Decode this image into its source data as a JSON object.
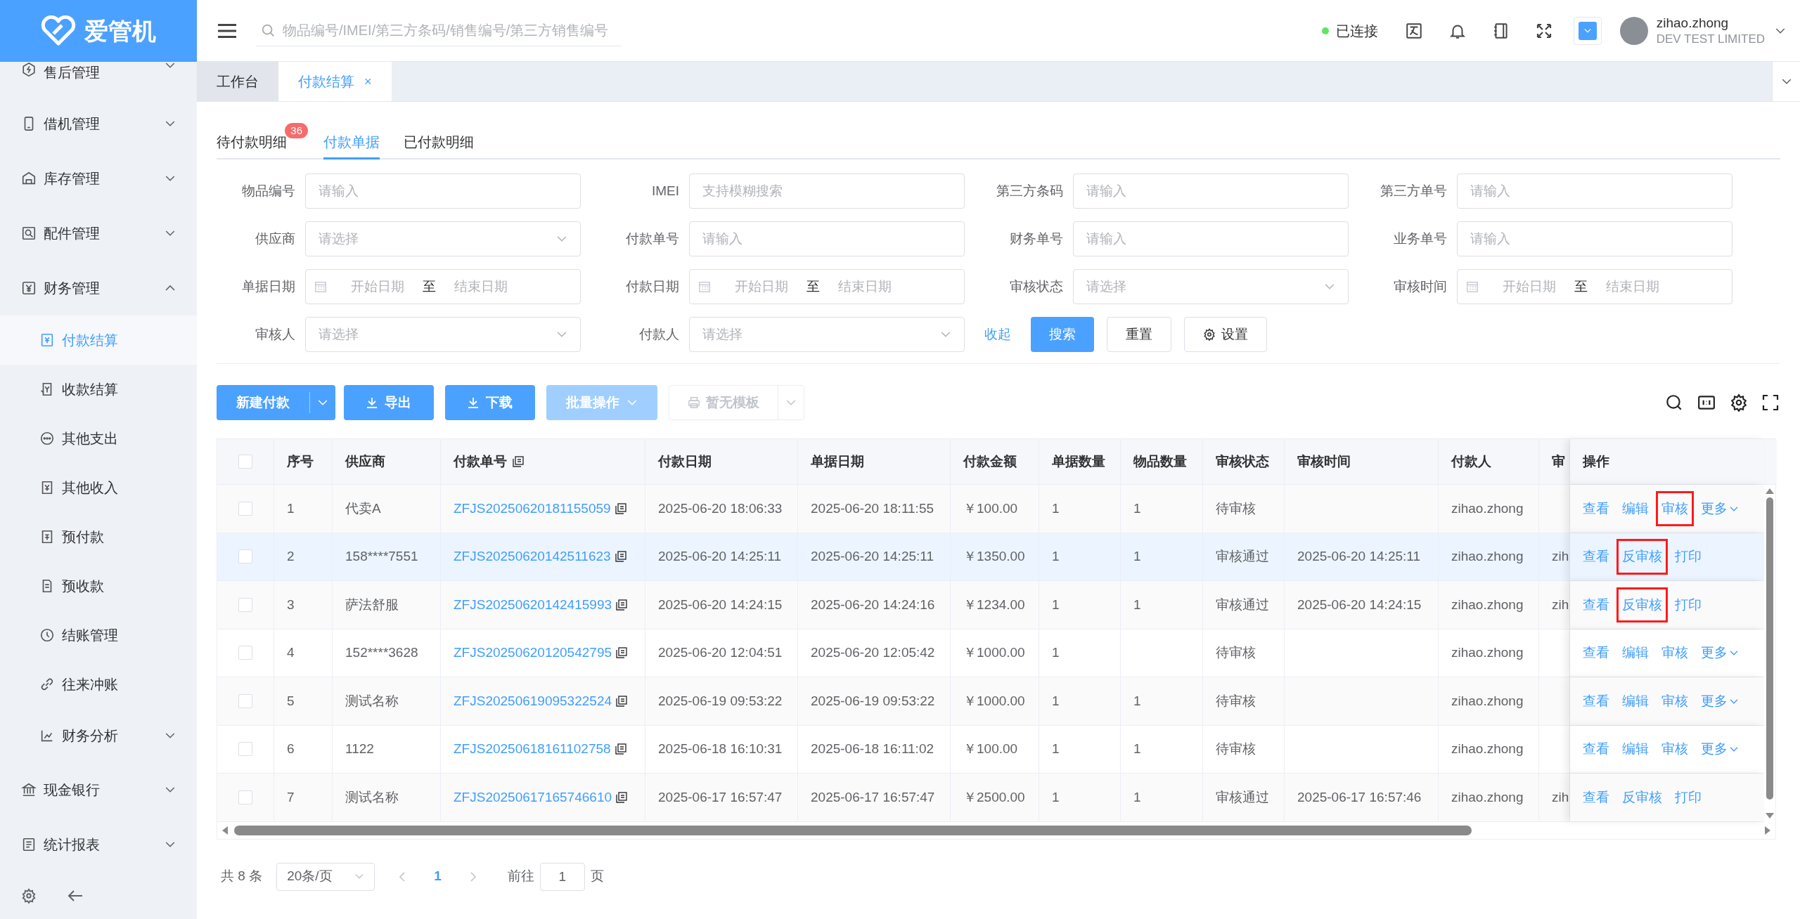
{
  "logo": {
    "text": "爱管机"
  },
  "topbar": {
    "search_placeholder": "物品编号/IMEI/第三方条码/销售编号/第三方销售编号",
    "connection": {
      "label": "已连接",
      "connected": true
    },
    "user": {
      "name": "zihao.zhong",
      "company": "DEV TEST LIMITED"
    }
  },
  "sidebar": {
    "items": [
      {
        "label": "售后管理",
        "expanded": false,
        "selected": false
      },
      {
        "label": "借机管理",
        "expanded": false,
        "selected": false
      },
      {
        "label": "库存管理",
        "expanded": false,
        "selected": false
      },
      {
        "label": "配件管理",
        "expanded": false,
        "selected": false
      },
      {
        "label": "财务管理",
        "expanded": true,
        "selected": false,
        "children": [
          {
            "label": "付款结算",
            "kind": "leaf",
            "selected": true
          },
          {
            "label": "收款结算",
            "kind": "leaf",
            "selected": false
          },
          {
            "label": "其他支出",
            "kind": "leaf",
            "selected": false
          },
          {
            "label": "其他收入",
            "kind": "leaf",
            "selected": false
          },
          {
            "label": "预付款",
            "kind": "leaf",
            "selected": false
          },
          {
            "label": "预收款",
            "kind": "leaf",
            "selected": false
          },
          {
            "label": "结账管理",
            "kind": "leaf",
            "selected": false
          },
          {
            "label": "往来冲账",
            "kind": "leaf",
            "selected": false
          },
          {
            "label": "财务分析",
            "kind": "group",
            "selected": false
          }
        ]
      },
      {
        "label": "现金银行",
        "expanded": false,
        "selected": false
      },
      {
        "label": "统计报表",
        "expanded": false,
        "selected": false
      }
    ]
  },
  "page_tabs": [
    {
      "label": "工作台",
      "selected": false
    },
    {
      "label": "付款结算",
      "selected": true,
      "close": "×"
    }
  ],
  "sub_tabs": [
    {
      "label": "待付款明细",
      "selected": false,
      "badge": "36"
    },
    {
      "label": "付款单据",
      "selected": true
    },
    {
      "label": "已付款明细",
      "selected": false
    }
  ],
  "filters": [
    {
      "label": "物品编号",
      "kind": "input",
      "placeholder": "请输入"
    },
    {
      "label": "IMEI",
      "kind": "input",
      "placeholder": "支持模糊搜索"
    },
    {
      "label": "第三方条码",
      "kind": "input",
      "placeholder": "请输入"
    },
    {
      "label": "第三方单号",
      "kind": "input",
      "placeholder": "请输入"
    },
    {
      "label": "供应商",
      "kind": "select",
      "placeholder": "请选择"
    },
    {
      "label": "付款单号",
      "kind": "input",
      "placeholder": "请输入"
    },
    {
      "label": "财务单号",
      "kind": "input",
      "placeholder": "请输入"
    },
    {
      "label": "业务单号",
      "kind": "input",
      "placeholder": "请输入"
    },
    {
      "label": "单据日期",
      "kind": "daterange",
      "start_placeholder": "开始日期",
      "separator": "至",
      "end_placeholder": "结束日期"
    },
    {
      "label": "付款日期",
      "kind": "daterange",
      "start_placeholder": "开始日期",
      "separator": "至",
      "end_placeholder": "结束日期"
    },
    {
      "label": "审核状态",
      "kind": "select",
      "placeholder": "请选择"
    },
    {
      "label": "审核时间",
      "kind": "daterange",
      "start_placeholder": "开始日期",
      "separator": "至",
      "end_placeholder": "结束日期"
    },
    {
      "label": "审核人",
      "kind": "select",
      "placeholder": "请选择"
    },
    {
      "label": "付款人",
      "kind": "select",
      "placeholder": "请选择"
    }
  ],
  "filter_actions": {
    "collapse": "收起",
    "search": "搜索",
    "reset": "重置",
    "settings": "设置"
  },
  "toolbar": {
    "buttons": [
      {
        "label": "新建付款",
        "kind": "split",
        "disabled": false
      },
      {
        "label": "导出",
        "kind": "download",
        "disabled": false
      },
      {
        "label": "下载",
        "kind": "download",
        "disabled": false
      },
      {
        "label": "批量操作",
        "kind": "dropdown",
        "disabled": true
      },
      {
        "label": "暂无模板",
        "kind": "print",
        "disabled": true
      }
    ]
  },
  "table": {
    "columns": [
      {
        "label": "序号",
        "kind": "text"
      },
      {
        "label": "供应商",
        "kind": "text"
      },
      {
        "label": "付款单号",
        "kind": "link"
      },
      {
        "label": "付款日期",
        "kind": "text"
      },
      {
        "label": "单据日期",
        "kind": "text"
      },
      {
        "label": "付款金额",
        "kind": "text"
      },
      {
        "label": "单据数量",
        "kind": "text"
      },
      {
        "label": "物品数量",
        "kind": "text"
      },
      {
        "label": "审核状态",
        "kind": "text"
      },
      {
        "label": "审核时间",
        "kind": "text"
      },
      {
        "label": "付款人",
        "kind": "text"
      },
      {
        "label": "审",
        "kind": "text"
      }
    ],
    "actions_header": "操作",
    "all_checked": false,
    "rows": [
      {
        "checked": false,
        "selected": false,
        "cells": [
          "1",
          "代卖A",
          "ZFJS20250620181155059",
          "2025-06-20 18:06:33",
          "2025-06-20 18:11:55",
          "￥100.00",
          "1",
          "1",
          "待审核",
          null,
          "zihao.zhong",
          null
        ],
        "actions": [
          {
            "label": "查看",
            "kind": "link",
            "highlighted": false
          },
          {
            "label": "编辑",
            "kind": "link",
            "highlighted": false
          },
          {
            "label": "审核",
            "kind": "link",
            "highlighted": true
          },
          {
            "label": "更多",
            "kind": "more",
            "highlighted": false
          }
        ]
      },
      {
        "checked": false,
        "selected": true,
        "cells": [
          "2",
          "158****7551",
          "ZFJS20250620142511623",
          "2025-06-20 14:25:11",
          "2025-06-20 14:25:11",
          "￥1350.00",
          "1",
          "1",
          "审核通过",
          "2025-06-20 14:25:11",
          "zihao.zhong",
          "zih"
        ],
        "actions": [
          {
            "label": "查看",
            "kind": "link",
            "highlighted": false
          },
          {
            "label": "反审核",
            "kind": "link",
            "highlighted": true
          },
          {
            "label": "打印",
            "kind": "link",
            "highlighted": false
          }
        ]
      },
      {
        "checked": false,
        "selected": false,
        "cells": [
          "3",
          "萨法舒服",
          "ZFJS20250620142415993",
          "2025-06-20 14:24:15",
          "2025-06-20 14:24:16",
          "￥1234.00",
          "1",
          "1",
          "审核通过",
          "2025-06-20 14:24:15",
          "zihao.zhong",
          "zih"
        ],
        "actions": [
          {
            "label": "查看",
            "kind": "link",
            "highlighted": false
          },
          {
            "label": "反审核",
            "kind": "link",
            "highlighted": true
          },
          {
            "label": "打印",
            "kind": "link",
            "highlighted": false
          }
        ]
      },
      {
        "checked": false,
        "selected": false,
        "cells": [
          "4",
          "152****3628",
          "ZFJS20250620120542795",
          "2025-06-20 12:04:51",
          "2025-06-20 12:05:42",
          "￥1000.00",
          "1",
          null,
          "待审核",
          null,
          "zihao.zhong",
          null
        ],
        "actions": [
          {
            "label": "查看",
            "kind": "link",
            "highlighted": false
          },
          {
            "label": "编辑",
            "kind": "link",
            "highlighted": false
          },
          {
            "label": "审核",
            "kind": "link",
            "highlighted": false
          },
          {
            "label": "更多",
            "kind": "more",
            "highlighted": false
          }
        ]
      },
      {
        "checked": false,
        "selected": false,
        "cells": [
          "5",
          "测试名称",
          "ZFJS20250619095322524",
          "2025-06-19 09:53:22",
          "2025-06-19 09:53:22",
          "￥1000.00",
          "1",
          "1",
          "待审核",
          null,
          "zihao.zhong",
          null
        ],
        "actions": [
          {
            "label": "查看",
            "kind": "link",
            "highlighted": false
          },
          {
            "label": "编辑",
            "kind": "link",
            "highlighted": false
          },
          {
            "label": "审核",
            "kind": "link",
            "highlighted": false
          },
          {
            "label": "更多",
            "kind": "more",
            "highlighted": false
          }
        ]
      },
      {
        "checked": false,
        "selected": false,
        "cells": [
          "6",
          "1122",
          "ZFJS20250618161102758",
          "2025-06-18 16:10:31",
          "2025-06-18 16:11:02",
          "￥100.00",
          "1",
          "1",
          "待审核",
          null,
          "zihao.zhong",
          null
        ],
        "actions": [
          {
            "label": "查看",
            "kind": "link",
            "highlighted": false
          },
          {
            "label": "编辑",
            "kind": "link",
            "highlighted": false
          },
          {
            "label": "审核",
            "kind": "link",
            "highlighted": false
          },
          {
            "label": "更多",
            "kind": "more",
            "highlighted": false
          }
        ]
      },
      {
        "checked": false,
        "selected": false,
        "cells": [
          "7",
          "测试名称",
          "ZFJS20250617165746610",
          "2025-06-17 16:57:47",
          "2025-06-17 16:57:47",
          "￥2500.00",
          "1",
          "1",
          "审核通过",
          "2025-06-17 16:57:46",
          "zihao.zhong",
          "zih"
        ],
        "actions": [
          {
            "label": "查看",
            "kind": "link",
            "highlighted": false
          },
          {
            "label": "反审核",
            "kind": "link",
            "highlighted": false
          },
          {
            "label": "打印",
            "kind": "link",
            "highlighted": false
          }
        ]
      }
    ]
  },
  "pagination": {
    "total": "共 8 条",
    "page_size": "20条/页",
    "pages": [
      {
        "label": "1",
        "selected": true
      }
    ],
    "goto_label": "前往",
    "goto_value": "1",
    "goto_suffix": "页"
  }
}
